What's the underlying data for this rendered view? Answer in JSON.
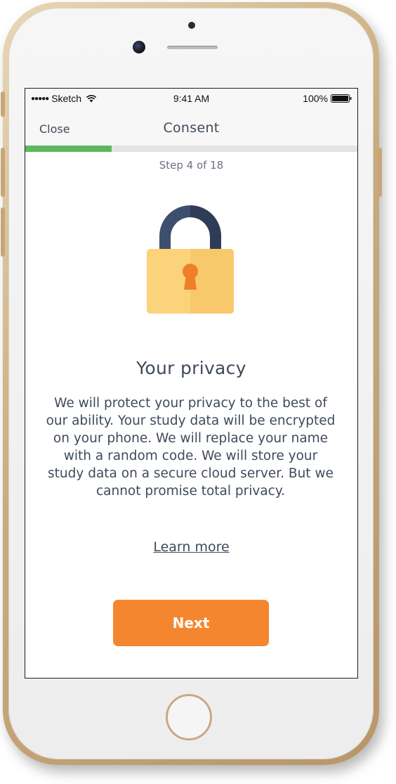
{
  "status_bar": {
    "carrier": "Sketch",
    "time": "9:41 AM",
    "battery": "100%",
    "icons": [
      "signal-icon",
      "wifi-icon",
      "battery-icon"
    ]
  },
  "nav": {
    "close_label": "Close",
    "title": "Consent"
  },
  "progress": {
    "current_step": 4,
    "total_steps": 18,
    "step_label": "Step 4 of 18",
    "fraction": 0.26
  },
  "content": {
    "icon": "lock-icon",
    "heading": "Your privacy",
    "body": "We will protect your privacy to the best of our ability. Your study data will be encrypted on your phone. We will replace your name with a random code. We will store your study data on a secure cloud server. But we cannot promise total privacy.",
    "learn_more": "Learn more",
    "next_label": "Next"
  },
  "colors": {
    "progress_fill": "#5cb85c",
    "primary_button": "#f4862f",
    "text": "#3f4a5b",
    "lock_body": "#fbd37a",
    "lock_shackle": "#3e4e6e",
    "keyhole": "#f07f2a"
  }
}
